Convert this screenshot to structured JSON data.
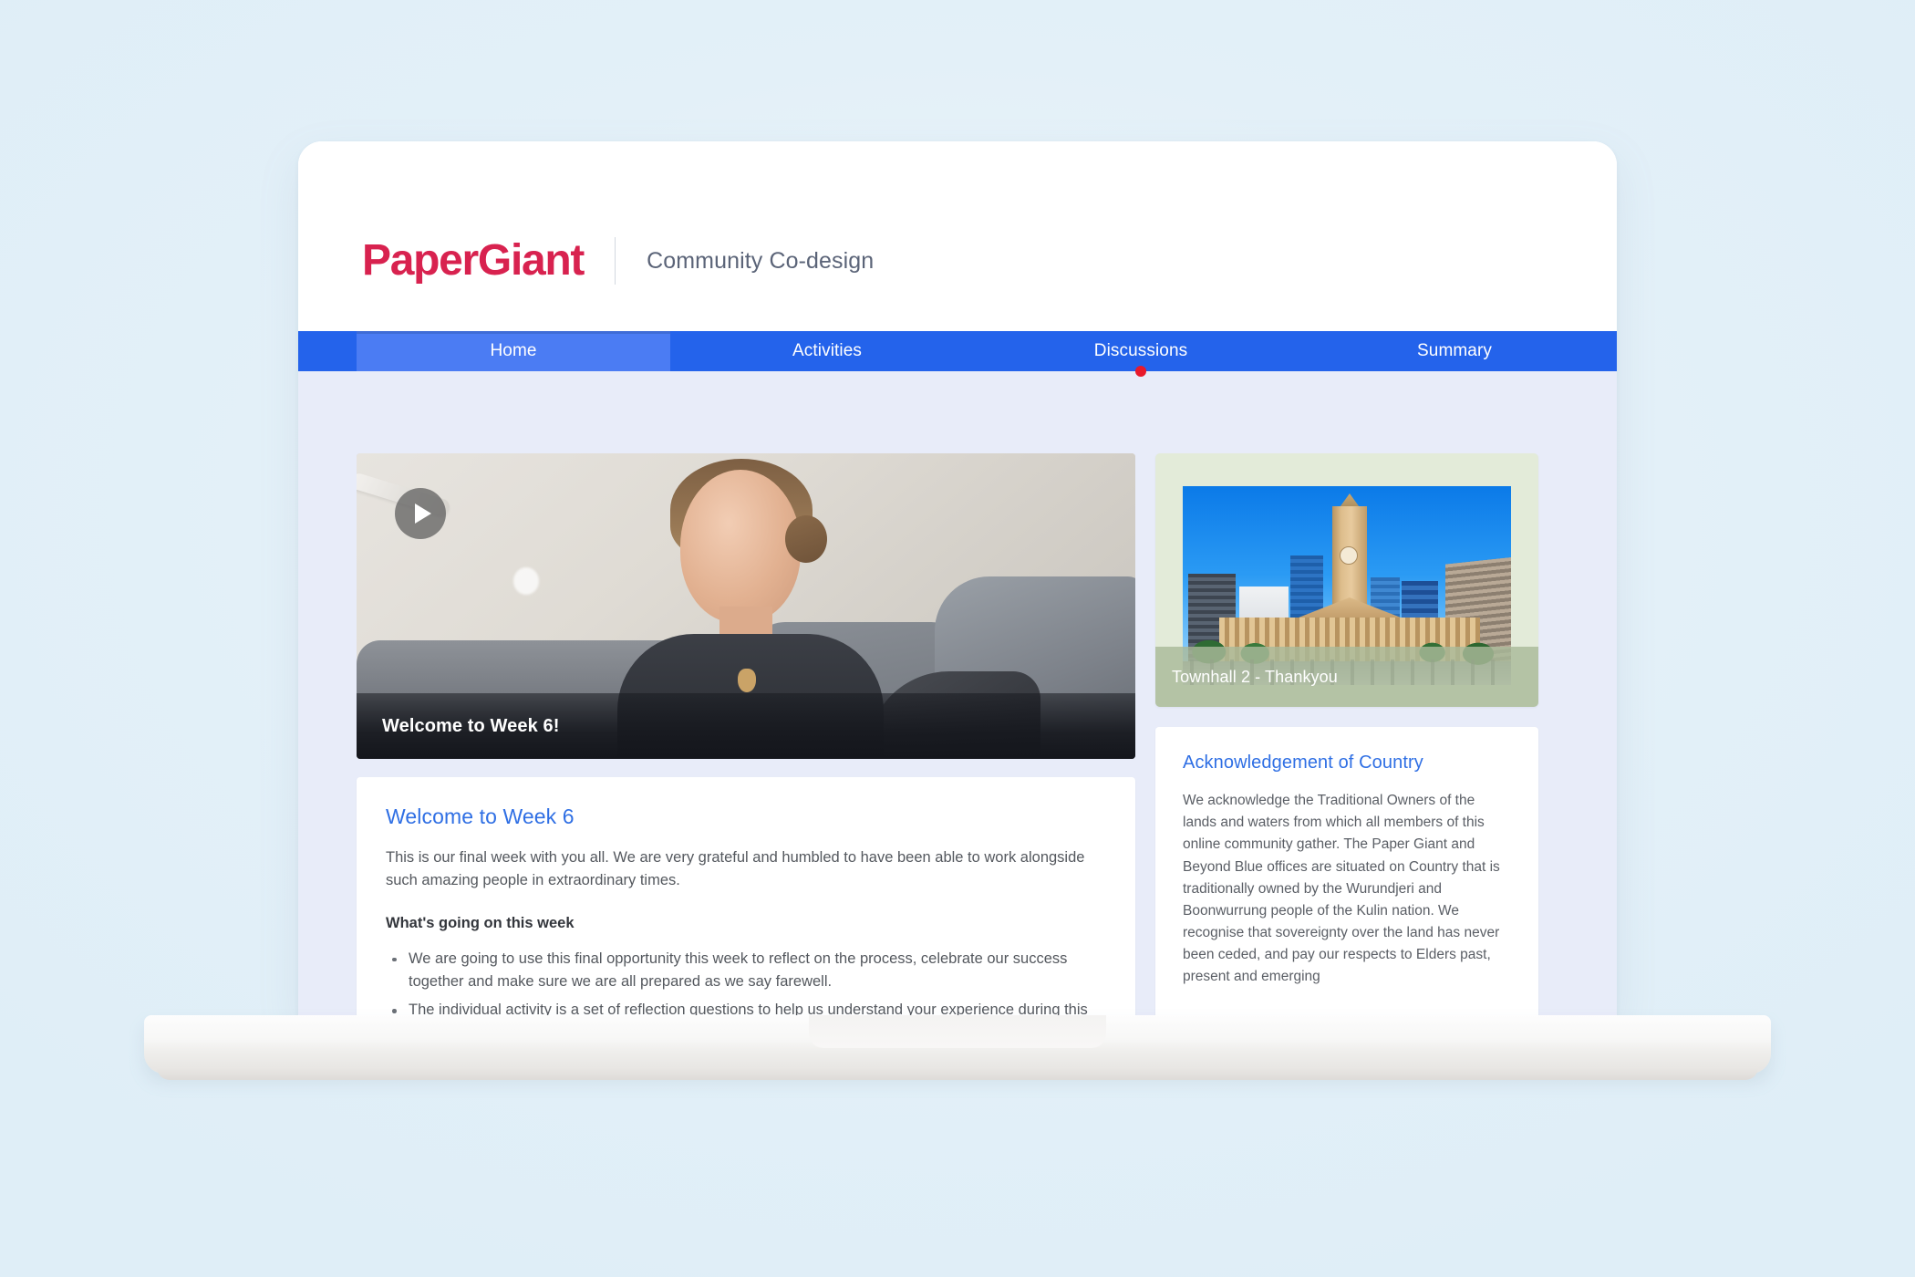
{
  "brand": {
    "logo": "PaperGiant",
    "subtitle": "Community Co-design",
    "logo_color": "#d8224f",
    "subtitle_color": "#5b6478"
  },
  "nav": {
    "background_color": "#2463eb",
    "active_color": "#4b7cf3",
    "notification_dot_color": "#e8192c",
    "tabs": [
      {
        "label": "Home",
        "active": true,
        "dot": false
      },
      {
        "label": "Activities",
        "active": false,
        "dot": false
      },
      {
        "label": "Discussions",
        "active": false,
        "dot": true
      },
      {
        "label": "Summary",
        "active": false,
        "dot": false
      }
    ]
  },
  "video": {
    "play_icon": "play-icon",
    "caption": "Welcome to Week 6!"
  },
  "article": {
    "title": "Welcome to Week 6",
    "title_color": "#2f6fe4",
    "intro": "This is our final week with you all. We are very grateful and humbled to have been able to work alongside such amazing people in extraordinary times.",
    "subheading": "What's going on this week",
    "bullets": [
      "We are going to use this final opportunity this week to reflect on the process, celebrate our success together and make sure we are all prepared as we say farewell.",
      "The individual activity is a set of reflection questions to help us understand your experience during this project. Please be as honest as possible. We also have some questions in there about how you would like to be communicated and engaged with post this project and see if you are interested in some of the ways you"
    ]
  },
  "townhall": {
    "label": "Townhall 2 - Thankyou",
    "card_background": "#e3ebd9",
    "overlay_color": "rgba(169,186,154,0.82)",
    "image_alt": "brisbane-city-hall-photo"
  },
  "acknowledgement": {
    "title": "Acknowledgement of Country",
    "title_color": "#2f6fe4",
    "body": "We acknowledge the Traditional Owners of the lands and waters from which all members of this online community gather. The Paper Giant and Beyond Blue offices are situated on Country that is traditionally owned by the Wurundjeri and Boonwurrung people of the Kulin nation. We recognise that sovereignty over the land has never been ceded, and pay our respects to Elders past, present and emerging",
    "flags": [
      {
        "name": "aboriginal-flag",
        "color": "#000000"
      },
      {
        "name": "torres-strait-islander-flag",
        "color": "#079b64"
      }
    ]
  },
  "page": {
    "content_background": "#e8ecf9",
    "scene_background": "#e4f1f8"
  }
}
